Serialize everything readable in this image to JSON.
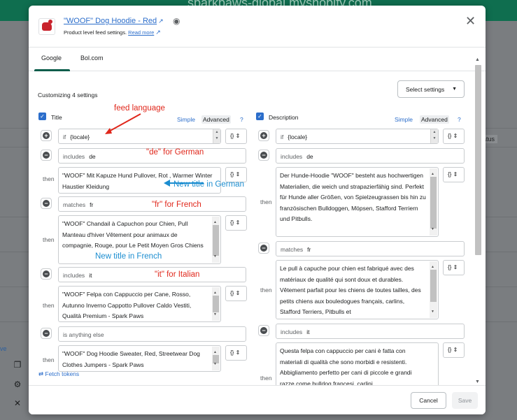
{
  "background": {
    "url_text": "sparkpaws-global.myshopify.com",
    "status_col": "atus",
    "link_text": "ve"
  },
  "modal": {
    "product_title": "\"WOOF\" Dog Hoodie - Red",
    "subtitle": "Product level feed settings.",
    "read_more": "Read more",
    "tabs": [
      "Google",
      "Bol.com"
    ],
    "customizing": "Customizing 4 settings",
    "select_settings": "Select settings",
    "fetch_tokens": "Fetch tokens",
    "cancel": "Cancel",
    "save": "Save"
  },
  "title_col": {
    "heading": "Title",
    "simple": "Simple",
    "advanced": "Advanced",
    "help": "?",
    "if_kw": "if",
    "if_value": "{locale}",
    "rules": [
      {
        "kw": "includes",
        "value": "de",
        "then": "\"WOOF\" Mit Kapuze Hund Pullover, Rot , Warmer Winter Haustier Kleidung"
      },
      {
        "kw": "matches",
        "value": "fr",
        "then": "\"WOOF\" Chandail à Capuchon pour Chien, Pull Manteau d'hiver Vêtement pour animaux de compagnie, Rouge,  pour Le Petit Moyen Gros Chiens"
      },
      {
        "kw": "includes",
        "value": "it",
        "then": "\"WOOF\" Felpa con Cappuccio per Cane, Rosso, Autunno Inverno Cappotto Pullover Caldo Vestiti, Qualità Premium - Spark Paws"
      },
      {
        "kw": "is anything else",
        "value": "",
        "then": "\"WOOF\" Dog Hoodie Sweater, Red, Streetwear Dog Clothes Jumpers - Spark Paws"
      }
    ]
  },
  "desc_col": {
    "heading": "Description",
    "simple": "Simple",
    "advanced": "Advanced",
    "help": "?",
    "if_kw": "if",
    "if_value": "{locale}",
    "rules": [
      {
        "kw": "includes",
        "value": "de",
        "then": "Der Hunde-Hoodie \"WOOF\" besteht aus hochwertigen Materialien, die weich und strapazierfähig sind. Perfekt für Hunde aller Größen, von Spielzeugrassen bis hin zu französischen Bulldoggen, Möpsen, Stafford Terriern und Pitbulls."
      },
      {
        "kw": "matches",
        "value": "fr",
        "then": "Le pull à capuche pour chien est fabriqué avec des matériaux de qualité qui sont doux et durables. Vêtement parfait pour les chiens de toutes tailles, des petits chiens aux bouledogues français, carlins, Stafford Terriers, Pitbulls et"
      },
      {
        "kw": "includes",
        "value": "it",
        "then": "Questa felpa con cappuccio per cani è fatta con materiali di qualità che sono morbidi e resistenti. Abbigliamento perfetto per cani di piccole e grandi razze come bulldog francesi, carlini,"
      }
    ]
  },
  "braces": "{}",
  "then_label": "then",
  "annotations": {
    "feed_language": "feed language",
    "de_german": "\"de\" for German",
    "new_title_german": "New title in German",
    "fr_french": "\"fr\" for French",
    "new_title_french": "New title in French",
    "it_italian": "\"it\" for Italian"
  },
  "colors": {
    "accent_blue": "#2c6ecb",
    "annotation_red": "#e0271b",
    "annotation_blue": "#1b8dd0",
    "tab_underline": "#0b5d4b"
  }
}
